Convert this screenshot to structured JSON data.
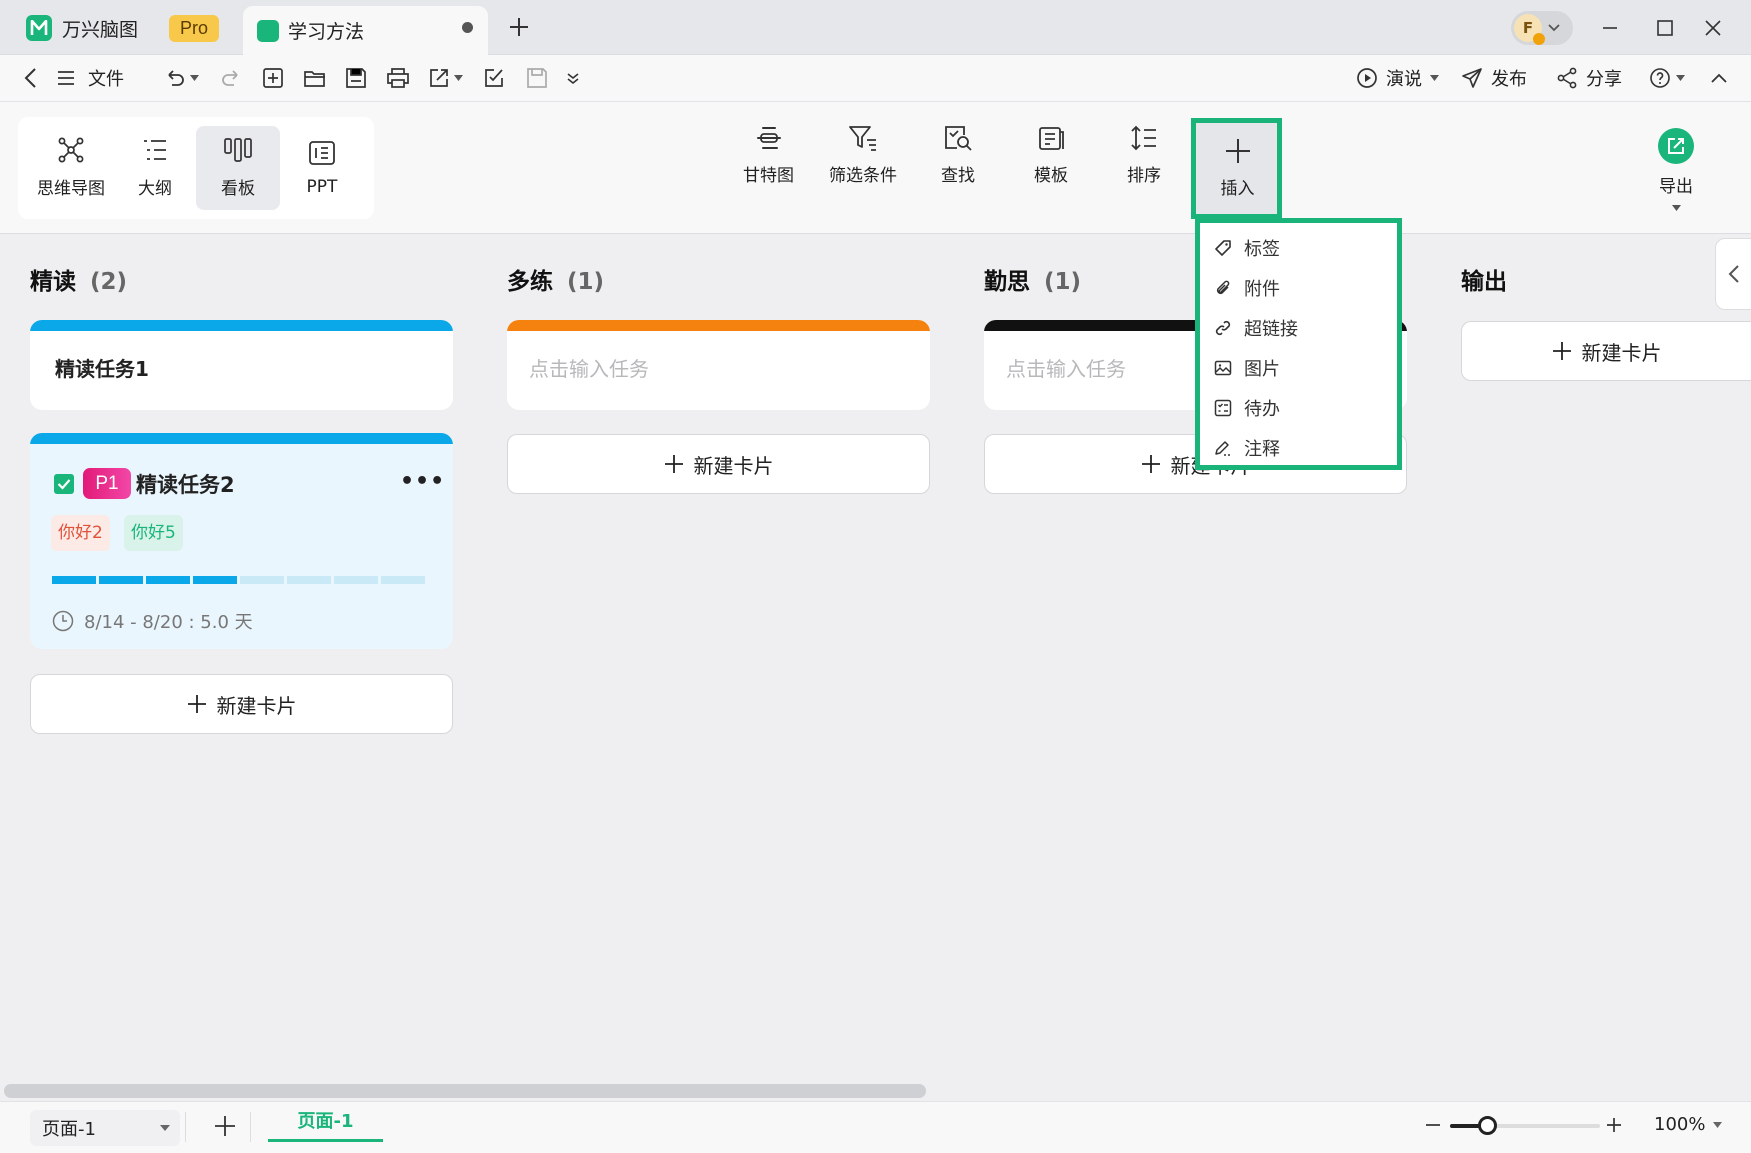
{
  "app": {
    "name": "万兴脑图",
    "badge": "Pro"
  },
  "document_tab": {
    "title": "学习方法"
  },
  "avatar": {
    "initial": "F"
  },
  "quickbar": {
    "file_label": "文件",
    "present_label": "演说",
    "publish_label": "发布",
    "share_label": "分享"
  },
  "views": [
    {
      "label": "思维导图",
      "icon": "mindmap-icon"
    },
    {
      "label": "大纲",
      "icon": "outline-icon"
    },
    {
      "label": "看板",
      "icon": "kanban-icon",
      "active": true
    },
    {
      "label": "PPT",
      "icon": "ppt-icon"
    }
  ],
  "tools": {
    "gantt": "甘特图",
    "filter": "筛选条件",
    "find": "查找",
    "template": "模板",
    "sort": "排序",
    "insert": "插入",
    "export": "导出"
  },
  "insert_menu": [
    "标签",
    "附件",
    "超链接",
    "图片",
    "待办",
    "注释"
  ],
  "columns": [
    {
      "title": "精读",
      "count": "(2)",
      "color": "#0aa8e8"
    },
    {
      "title": "多练",
      "count": "(1)",
      "color": "#f5820f"
    },
    {
      "title": "勤思",
      "count": "(1)",
      "color": "#111111"
    },
    {
      "title": "输出",
      "count": ""
    }
  ],
  "cards": {
    "task1": "精读任务1",
    "placeholder": "点击输入任务",
    "task2": {
      "checked": true,
      "priority": "P1",
      "title": "精读任务2",
      "tags": [
        "你好2",
        "你好5"
      ],
      "progress": 0.5,
      "time": "8/14 - 8/20 : 5.0 天"
    },
    "new_card": "新建卡片"
  },
  "status": {
    "page_select": "页面-1",
    "page_tab": "页面-1",
    "zoom": "100%",
    "zoom_level": 0.25
  },
  "colors": {
    "accent": "#19b57a",
    "highlight": "#1ab37a",
    "blue": "#0aa8e8",
    "orange": "#f5820f",
    "pink": "#e21a77"
  }
}
